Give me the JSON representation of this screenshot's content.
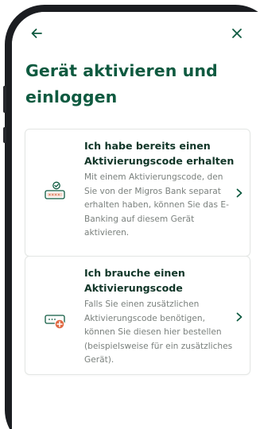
{
  "header": {
    "title": "Gerät aktivieren und einloggen"
  },
  "options": [
    {
      "title": "Ich habe bereits einen Aktivierungscode erhalten",
      "description": "Mit einem Aktivierungscode, den Sie von der Migros Bank separat erhalten haben, können Sie das E-Banking auf diesem Gerät aktivieren.",
      "icon": "code-received-icon"
    },
    {
      "title": "Ich brauche einen Aktivierungscode",
      "description": "Falls Sie einen zusätzlichen Aktivierungscode benötigen, können Sie diesen hier bestellen (beispielsweise für ein zusätzliches Gerät).",
      "icon": "code-request-icon"
    }
  ],
  "colors": {
    "accent": "#0e5a40",
    "icon_accent": "#d6603d",
    "text_muted": "#7a807d"
  }
}
